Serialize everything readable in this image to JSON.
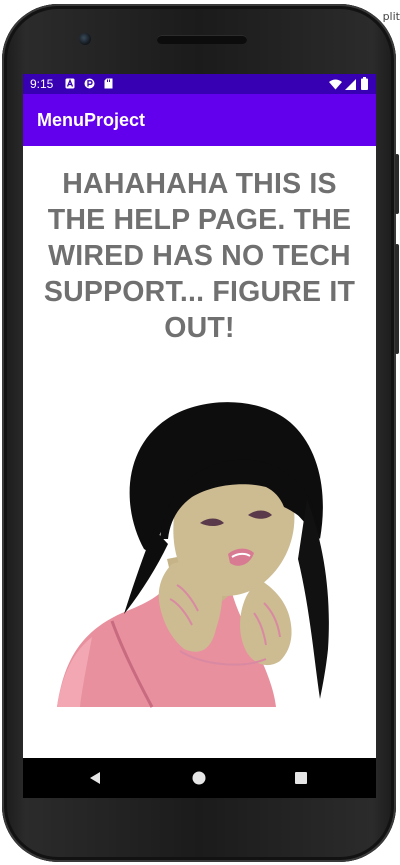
{
  "status_bar": {
    "time": "9:15",
    "left_icons": [
      "a-badge-icon",
      "p-badge-icon",
      "sd-card-icon"
    ],
    "right_icons": [
      "wifi-icon",
      "signal-icon",
      "battery-icon"
    ]
  },
  "app_bar": {
    "title": "MenuProject"
  },
  "content": {
    "help_text": "HAHAHAHA THIS IS THE HELP PAGE. THE WIRED HAS NO TECH SUPPORT... FIGURE IT OUT!",
    "image_subject": "anime-girl-illustration"
  },
  "nav_bar": {
    "buttons": [
      "back-icon",
      "home-icon",
      "recents-icon"
    ]
  },
  "edge_text": "plit",
  "colors": {
    "status_bar": "#3700b3",
    "app_bar": "#6200ee",
    "help_text": "#707070"
  }
}
